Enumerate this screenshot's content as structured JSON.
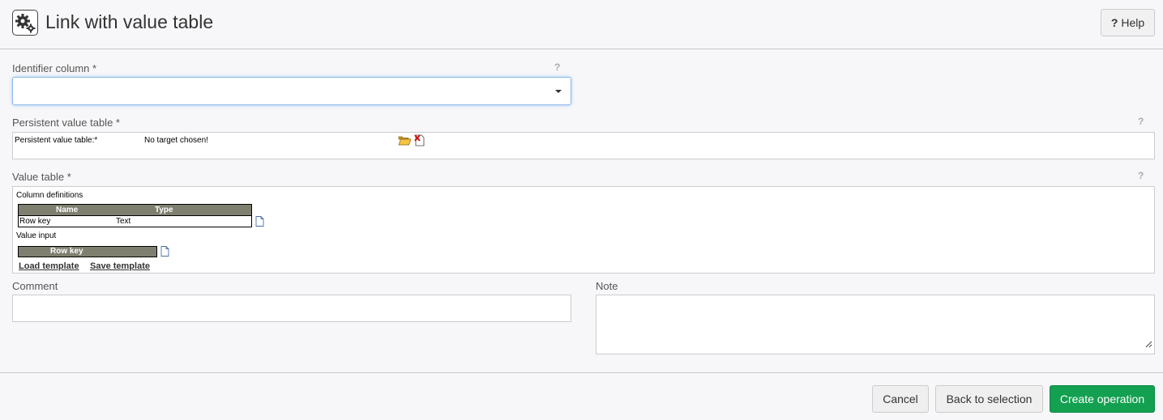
{
  "header": {
    "app_icon": "gears-icon",
    "title": "Link with value table",
    "help_label": "Help",
    "help_icon_glyph": "?"
  },
  "identifier_column": {
    "label": "Identifier column *",
    "help_glyph": "?",
    "value": ""
  },
  "persistent_value_table": {
    "label": "Persistent value table *",
    "help_glyph": "?",
    "field_label": "Persistent value table:*",
    "status_text": "No target chosen!",
    "open_icon": "folder-open-icon",
    "remove_icon": "document-delete-icon"
  },
  "value_table": {
    "label": "Value table *",
    "help_glyph": "?",
    "column_definitions_label": "Column definitions",
    "columns_header": [
      "Name",
      "Type"
    ],
    "rows": [
      {
        "name": "Row key",
        "type": "Text"
      }
    ],
    "value_input_label": "Value input",
    "value_input_header": [
      "Row key"
    ],
    "load_template_label": "Load template",
    "save_template_label": "Save template"
  },
  "comment": {
    "label": "Comment",
    "value": ""
  },
  "note": {
    "label": "Note",
    "value": ""
  },
  "footer": {
    "cancel_label": "Cancel",
    "back_label": "Back to selection",
    "create_label": "Create operation"
  },
  "colors": {
    "primary_button": "#13a050",
    "table_header": "#7f7f6f",
    "focus_border": "#8fb8e8"
  }
}
